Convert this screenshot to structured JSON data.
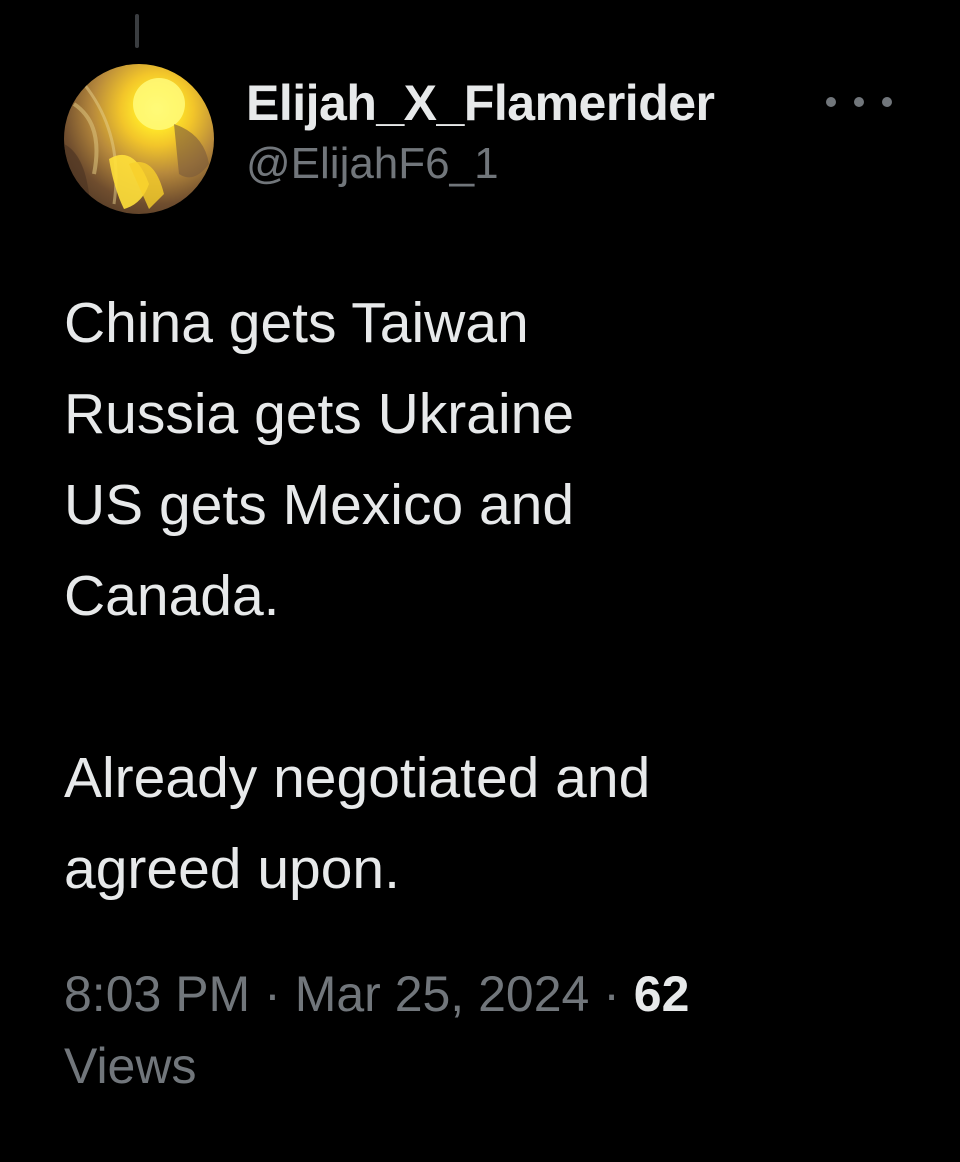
{
  "author": {
    "display_name": "Elijah_X_Flamerider",
    "handle": "@ElijahF6_1"
  },
  "icons": {
    "avatar": "profile-avatar",
    "more": "more-options-icon"
  },
  "tweet": {
    "lines": [
      "China gets Taiwan",
      "Russia gets Ukraine",
      "US gets Mexico and",
      "Canada.",
      "",
      "Already negotiated and",
      "agreed upon."
    ]
  },
  "meta": {
    "time": "8:03 PM",
    "separator": "·",
    "date": "Mar 25, 2024",
    "views_count": "62",
    "views_label": "Views"
  },
  "colors": {
    "background": "#000000",
    "primary_text": "#e7e9ea",
    "secondary_text": "#71767b"
  }
}
